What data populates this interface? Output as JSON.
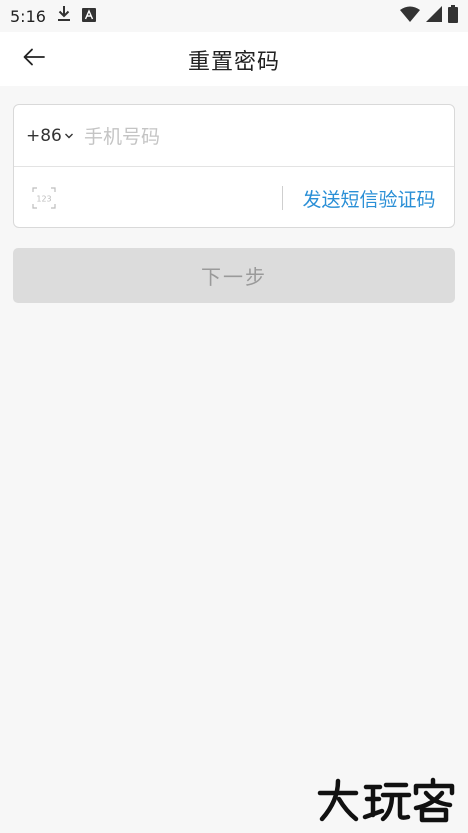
{
  "status_bar": {
    "time": "5:16",
    "left_icons": [
      "download-icon",
      "app-a-icon"
    ],
    "right_icons": [
      "wifi-icon",
      "signal-icon",
      "battery-icon"
    ]
  },
  "header": {
    "back_icon": "arrow-left-icon",
    "title": "重置密码"
  },
  "form": {
    "country_code": "+86",
    "phone_placeholder": "手机号码",
    "phone_value": "",
    "code_icon": "keypad-123-icon",
    "code_icon_text": "123",
    "code_placeholder": "",
    "code_value": "",
    "send_code_label": "发送短信验证码"
  },
  "next_button": {
    "label": "下一步"
  },
  "watermark": {
    "logo": "dawanke-logo-icon"
  },
  "colors": {
    "background": "#f7f7f7",
    "header_bg": "#ffffff",
    "link": "#2a8fd6",
    "button_disabled_bg": "#dcdcdc",
    "button_disabled_text": "#9a9a9a"
  }
}
